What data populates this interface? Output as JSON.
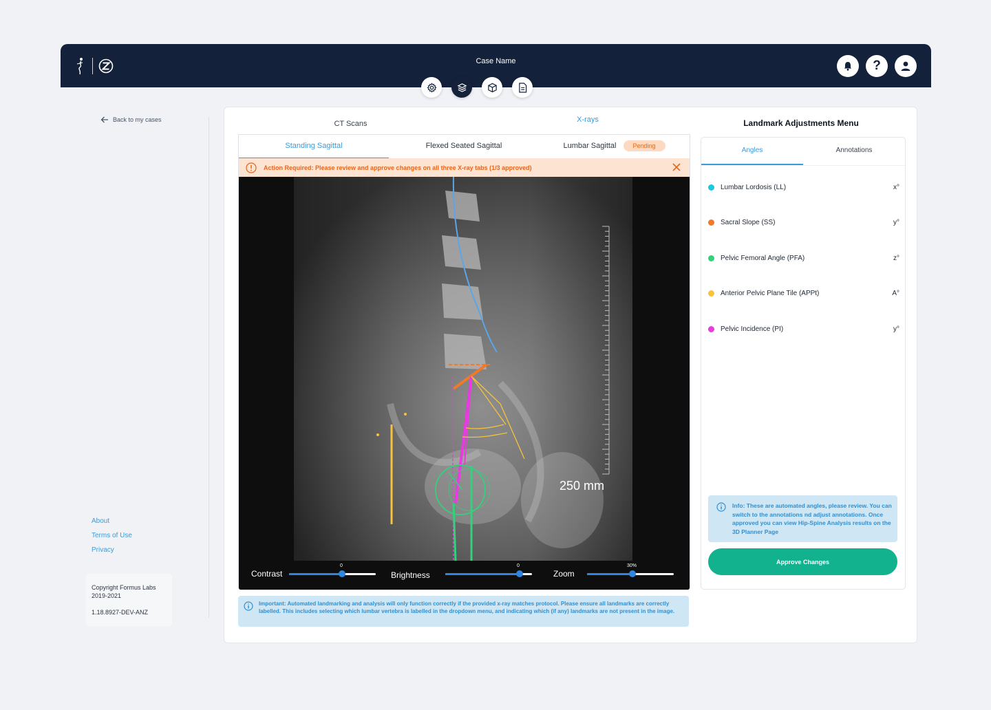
{
  "header": {
    "case_name": "Case Name",
    "logo_icon": "spine-figure-icon",
    "brand_icon": "z-brand-icon",
    "actions": [
      "bell-icon",
      "help-icon",
      "user-icon"
    ],
    "help_glyph": "?",
    "nav": [
      "gear-icon",
      "layers-icon",
      "cube-icon",
      "document-icon"
    ]
  },
  "sidebar": {
    "back_label": "Back to my cases",
    "links": [
      "About",
      "Terms of Use",
      "Privacy"
    ],
    "copyright": "Copyright Formus Labs 2019-2021",
    "version": "1.18.8927-DEV-ANZ"
  },
  "tabs": {
    "ct": "CT Scans",
    "xrays": "X-rays"
  },
  "subtabs": {
    "standing": "Standing Sagittal",
    "flexed": "Flexed Seated Sagittal",
    "lumbar": "Lumbar Sagittal",
    "pending": "Pending"
  },
  "alert": {
    "text": "Action Required: Please review and approve changes on all three X-ray tabs (1/3 approved)"
  },
  "viewer": {
    "scale_label": "250 mm",
    "contrast_label": "Contrast",
    "contrast_value": "0",
    "brightness_label": "Brightness",
    "brightness_value": "0",
    "zoom_label": "Zoom",
    "zoom_value": "30%"
  },
  "important": {
    "text": "Important: Automated landmarking and analysis will only function correctly if the provided x-ray matches protocol. Please ensure all landmarks are correctly labelled. This includes selecting which lumbar vertebra is labelled in the dropdown menu, and indicating which (if any) landmarks are not present in the image."
  },
  "right_panel": {
    "title": "Landmark Adjustments Menu",
    "tab_angles": "Angles",
    "tab_annotations": "Annotations",
    "angles": [
      {
        "name": "Lumbar Lordosis (LL)",
        "value": "x°",
        "color": "#1ec8dc"
      },
      {
        "name": "Sacral Slope (SS)",
        "value": "y°",
        "color": "#f07a2a"
      },
      {
        "name": "Pelvic Femoral Angle (PFA)",
        "value": "z°",
        "color": "#34d07c"
      },
      {
        "name": "Anterior Pelvic Plane Tile (APPt)",
        "value": "A°",
        "color": "#f6c33b"
      },
      {
        "name": "Pelvic Incidence (PI)",
        "value": "y°",
        "color": "#e83be0"
      }
    ],
    "info": "Info: These are automated angles, please review. You can switch to the annotations nd adjust annotations. Once approved you can view Hip-Spine Analysis results on the 3D Planner Page",
    "approve_label": "Approve Changes"
  }
}
